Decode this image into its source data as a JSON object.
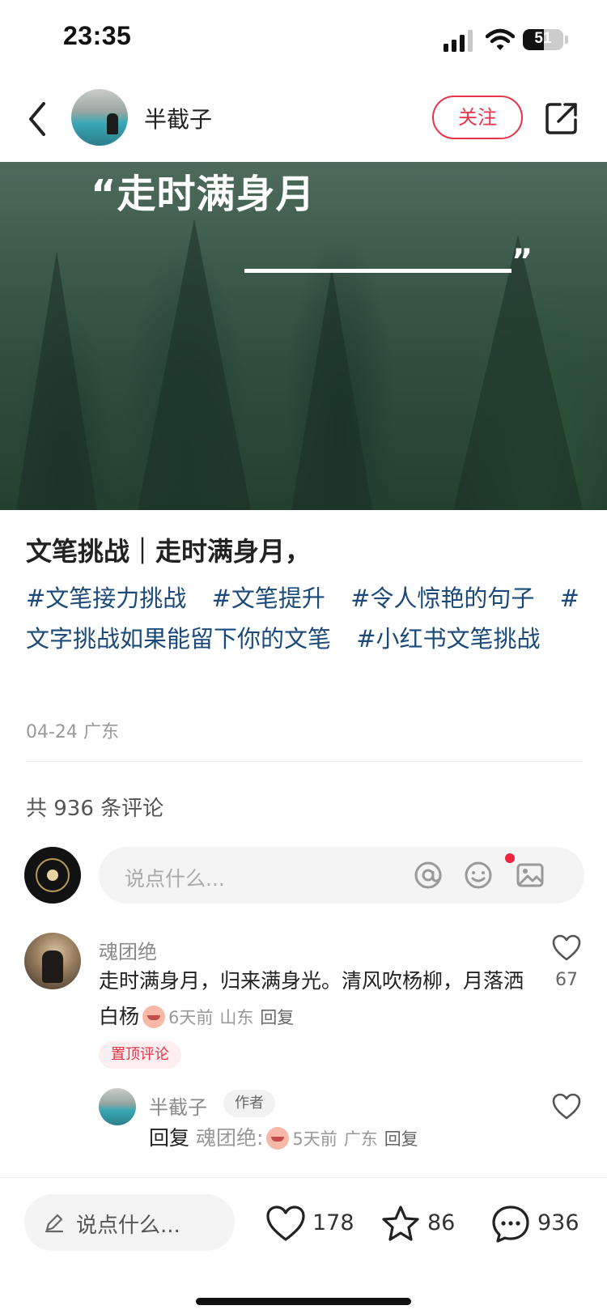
{
  "status_bar": {
    "time": "23:35",
    "battery": "51",
    "battery_level": 0.51
  },
  "header": {
    "author_name": "半截子",
    "follow_label": "关注",
    "icons": [
      "back-icon",
      "share-icon"
    ]
  },
  "hero": {
    "quote": "“走时满身月",
    "close_quote": "”"
  },
  "post": {
    "title": "文笔挑战｜走时满身月，",
    "tags": [
      "#文笔接力挑战",
      "#文笔提升",
      "#令人惊艳的句子",
      "#文字挑战如果能留下你的文笔",
      "#小红书文笔挑战"
    ],
    "date": "04-24",
    "location": "广东"
  },
  "comments_section": {
    "total_label": "共 936 条评论",
    "input_placeholder": "说点什么...",
    "input_icons": [
      "at-icon",
      "emoji-icon",
      "image-icon"
    ]
  },
  "comments": [
    {
      "name": "魂团绝",
      "text": "走时满身月，归来满身光。清风吹杨柳，月落洒白杨",
      "time": "6天前",
      "location": "山东",
      "reply_label": "回复",
      "pinned_label": "置顶评论",
      "likes": "67"
    }
  ],
  "reply": {
    "name": "半截子",
    "author_badge": "作者",
    "prefix": "回复",
    "target": "魂团绝:",
    "time": "5天前",
    "location": "广东",
    "reply_label": "回复"
  },
  "bottom_bar": {
    "input_placeholder": "说点什么...",
    "likes": "178",
    "stars": "86",
    "comments": "936"
  },
  "colors": {
    "accent": "#e8334a",
    "tag": "#1b4a7a"
  }
}
